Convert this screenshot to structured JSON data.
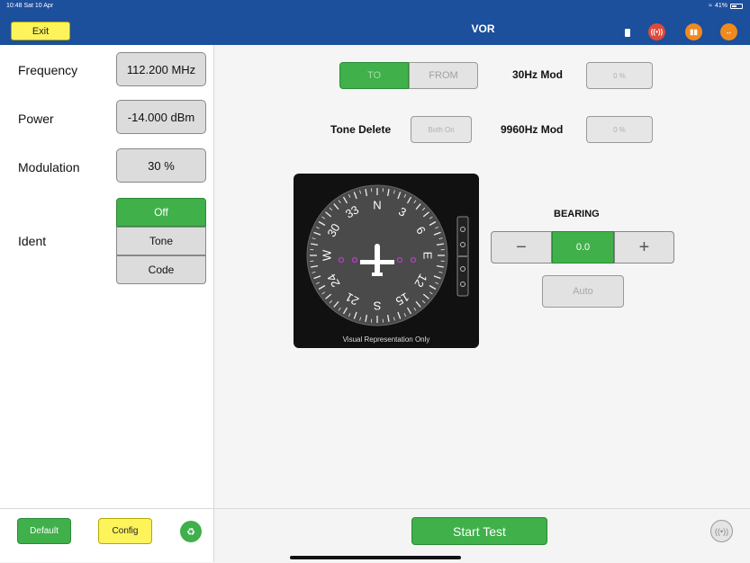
{
  "status_bar": {
    "time": "10:48  Sat 10 Apr",
    "battery": "41%"
  },
  "header": {
    "title": "VOR",
    "exit_label": "Exit",
    "icons": [
      "plug-icon",
      "transmit-icon",
      "book-icon",
      "swap-icon"
    ],
    "accent_color": "#1c4f9c"
  },
  "left": {
    "frequency": {
      "label": "Frequency",
      "value": "112.200 MHz"
    },
    "power": {
      "label": "Power",
      "value": "-14.000 dBm"
    },
    "modulation": {
      "label": "Modulation",
      "value": "30 %"
    },
    "ident": {
      "label": "Ident",
      "options": [
        "Off",
        "Tone",
        "Code"
      ],
      "selected": "Off"
    }
  },
  "footer": {
    "default_label": "Default",
    "config_label": "Config",
    "start_label": "Start Test"
  },
  "main": {
    "direction": {
      "to": "TO",
      "from": "FROM",
      "selected": "TO"
    },
    "mod30": {
      "label": "30Hz Mod",
      "value": "0 %"
    },
    "tone_delete": {
      "label": "Tone Delete",
      "value": "Both On"
    },
    "mod9960": {
      "label": "9960Hz Mod",
      "value": "0 %"
    },
    "compass": {
      "caption": "Visual Representation Only",
      "cardinals": [
        "N",
        "3",
        "6",
        "E",
        "12",
        "15",
        "S",
        "21",
        "24",
        "W",
        "30",
        "33"
      ]
    },
    "bearing": {
      "label": "BEARING",
      "value": "0.0",
      "minus": "−",
      "plus": "+",
      "auto_label": "Auto"
    }
  },
  "colors": {
    "green": "#3fb04a",
    "yellow": "#fdf35a",
    "orange": "#f08a1e",
    "red": "#e04a3a"
  }
}
